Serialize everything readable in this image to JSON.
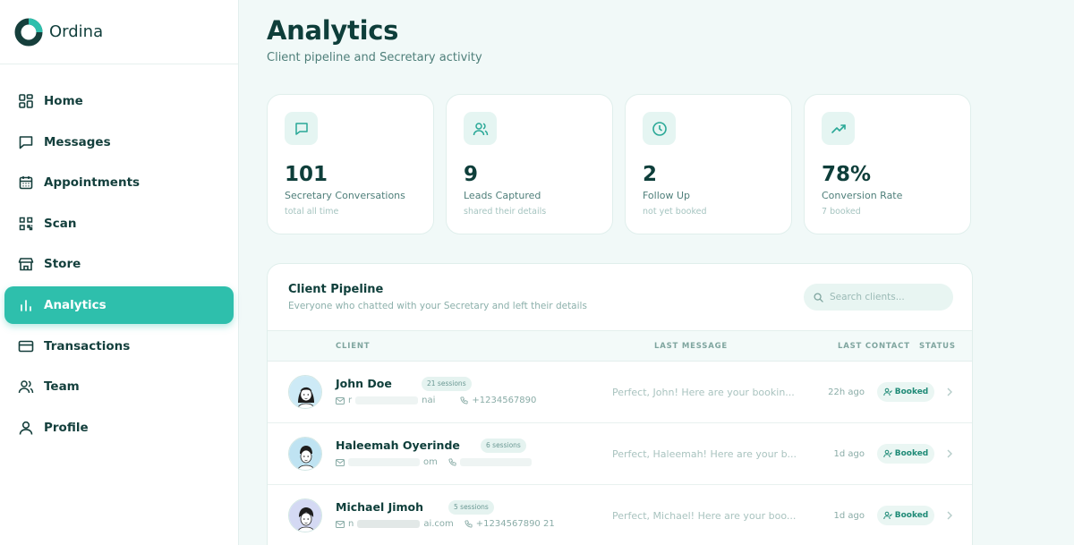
{
  "brand": {
    "name": "Ordina"
  },
  "nav": [
    {
      "label": "Home",
      "icon": "grid-icon"
    },
    {
      "label": "Messages",
      "icon": "message-icon"
    },
    {
      "label": "Appointments",
      "icon": "calendar-icon"
    },
    {
      "label": "Scan",
      "icon": "qr-icon"
    },
    {
      "label": "Store",
      "icon": "store-icon"
    },
    {
      "label": "Analytics",
      "icon": "bar-chart-icon",
      "active": true
    },
    {
      "label": "Transactions",
      "icon": "card-icon"
    },
    {
      "label": "Team",
      "icon": "team-icon"
    },
    {
      "label": "Profile",
      "icon": "user-icon"
    }
  ],
  "page": {
    "title": "Analytics",
    "subtitle": "Client pipeline and Secretary activity"
  },
  "stats": [
    {
      "value": "101",
      "label": "Secretary Conversations",
      "sub": "total all time",
      "icon": "chat-icon"
    },
    {
      "value": "9",
      "label": "Leads Captured",
      "sub": "shared their details",
      "icon": "users-icon"
    },
    {
      "value": "2",
      "label": "Follow Up",
      "sub": "not yet booked",
      "icon": "clock-icon"
    },
    {
      "value": "78%",
      "label": "Conversion Rate",
      "sub": "7 booked",
      "icon": "trend-up-icon"
    }
  ],
  "pipeline": {
    "title": "Client Pipeline",
    "subtitle": "Everyone who chatted with your Secretary and left their details",
    "search_placeholder": "Search clients...",
    "columns": {
      "client": "CLIENT",
      "last_message": "LAST MESSAGE",
      "last_contact": "LAST CONTACT",
      "status": "STATUS"
    },
    "rows": [
      {
        "name": "John Doe",
        "sessions": "21 sessions",
        "email_start": "r",
        "email_end": "nai",
        "phone": "+1234567890",
        "last_message": "Perfect, John! Here are your bookin...",
        "last_contact": "22h ago",
        "status": "Booked"
      },
      {
        "name": "Haleemah Oyerinde",
        "sessions": "6 sessions",
        "email_start": "",
        "email_end": "om",
        "phone": "",
        "last_message": "Perfect, Haleemah! Here are your b...",
        "last_contact": "1d ago",
        "status": "Booked"
      },
      {
        "name": "Michael Jimoh",
        "sessions": "5 sessions",
        "email_start": "n",
        "email_end": "ai.com",
        "phone": "+1234567890 21",
        "last_message": "Perfect, Michael! Here are your boo...",
        "last_contact": "1d ago",
        "status": "Booked"
      }
    ]
  },
  "colors": {
    "accent": "#2ebfac",
    "text": "#0e3e3a",
    "background": "#f1f9f8"
  }
}
